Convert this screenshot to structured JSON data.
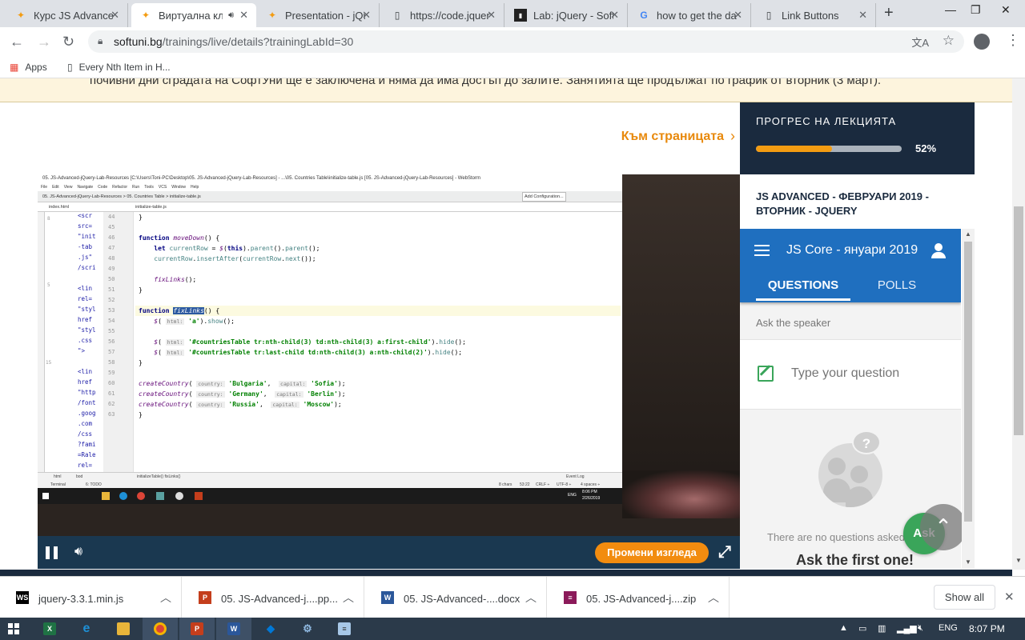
{
  "browser": {
    "tabs": [
      {
        "title": "Курс JS Advanced - ...",
        "icon": "softuni-icon"
      },
      {
        "title": "Виртуална класна стая",
        "icon": "softuni-icon",
        "active": true,
        "audio": true
      },
      {
        "title": "Presentation - jQuery",
        "icon": "softuni-icon"
      },
      {
        "title": "https://code.jquery.com",
        "icon": "document-icon"
      },
      {
        "title": "Lab: jQuery - SoftUni",
        "icon": "terminal-icon"
      },
      {
        "title": "how to get the data",
        "icon": "google-icon"
      },
      {
        "title": "Link Buttons",
        "icon": "document-icon"
      }
    ],
    "url_host": "softuni.bg",
    "url_path": "/trainings/live/details?trainingLabId=30",
    "bookmarks": [
      {
        "label": "Apps",
        "icon": "apps-grid-icon"
      },
      {
        "label": "Every Nth Item in H...",
        "icon": "document-icon"
      }
    ]
  },
  "page": {
    "notice": "почивни дни сградата на СофтУни ще е заключена и няма да има достъп до залите. Занятията ще продължат по график от вторник (3 март).",
    "page_link": "Към страницата",
    "progress_title": "ПРОГРЕС НА ЛЕКЦИЯТА",
    "progress_value": 0.52,
    "progress_label": "52%",
    "course_title": "JS ADVANCED - ФЕВРУАРИ 2019 - ВТОРНИК - JQUERY",
    "accent_color": "#f28c0f"
  },
  "video": {
    "change_view_label": "Промени изгледа",
    "ide": {
      "title": "05. JS-Advanced-jQuery-Lab-Resources [C:\\Users\\Toni-PC\\Desktop\\05. JS-Advanced-jQuery-Lab-Resources] - ...\\05. Countries Table\\initialize-table.js [05. JS-Advanced-jQuery-Lab-Resources] - WebStorm",
      "menu": [
        "File",
        "Edit",
        "View",
        "Navigate",
        "Code",
        "Refactor",
        "Run",
        "Tools",
        "VCS",
        "Window",
        "Help"
      ],
      "crumbs": [
        "05. JS-Advanced-jQuery-Lab-Resources",
        "05. Countries Table",
        "initialize-table.js"
      ],
      "add_config": "Add Configuration...",
      "file_tabs": [
        "index.html",
        "initialize-table.js"
      ],
      "gutter_lines": [
        "44",
        "45",
        "46",
        "47",
        "48",
        "49",
        "50",
        "51",
        "52",
        "53",
        "54",
        "55",
        "56",
        "57",
        "58",
        "59",
        "60",
        "61",
        "62",
        "63"
      ],
      "html_lines": [
        "<scr",
        "src=",
        "\"init",
        "-tab",
        ".js\"",
        "/scri",
        "",
        "<lin",
        "rel=",
        "\"styl",
        "href",
        "\"styl",
        ".css",
        "\">",
        "",
        "<lin",
        "href",
        "\"http",
        "/font",
        ".goog",
        ".com",
        "/css",
        "?fami",
        "=Rale",
        "rel="
      ],
      "html_gutter": [
        "8",
        "5",
        "15"
      ],
      "status_left": "initializeTable()  fixLinks()",
      "status_right": [
        "8 chars",
        "53:22",
        "CRLF ÷",
        "UTF-8 ÷",
        "4 spaces ÷"
      ],
      "event_log": "Event Log",
      "terminal_tab": "Terminal",
      "todo_tab": "6: TODO",
      "html_footer": [
        "html",
        "bod"
      ],
      "tray_time": "8:06 PM",
      "tray_date": "2/26/2019",
      "tray_lang": "ENG"
    }
  },
  "slido": {
    "event_name": "JS Core - януари 2019",
    "tab_questions": "QUESTIONS",
    "tab_polls": "POLLS",
    "ask_label": "Ask the speaker",
    "question_placeholder": "Type your question",
    "no_questions": "There are no questions asked yet.",
    "ask_first": "Ask the first one!",
    "ask_button": "Ask",
    "brand_color": "#1f6fbf"
  },
  "downloads": {
    "items": [
      {
        "name": "jquery-3.3.1.min.js",
        "icon": "webstorm-icon",
        "color": "#000000"
      },
      {
        "name": "05. JS-Advanced-j....pp...",
        "icon": "powerpoint-icon",
        "color": "#c43e1c"
      },
      {
        "name": "05. JS-Advanced-....docx",
        "icon": "word-icon",
        "color": "#2b579a"
      },
      {
        "name": "05. JS-Advanced-j....zip",
        "icon": "winrar-icon",
        "color": "#8b1a5a"
      }
    ],
    "show_all": "Show all"
  },
  "taskbar": {
    "apps": [
      {
        "icon": "excel-icon",
        "color": "#1f7244",
        "glyph": "X"
      },
      {
        "icon": "ie-icon",
        "color": "#1e90d6",
        "glyph": "e"
      },
      {
        "icon": "file-explorer-icon",
        "color": "#e8b53a",
        "glyph": ""
      },
      {
        "icon": "chrome-icon",
        "color": "#db4437",
        "glyph": ""
      },
      {
        "icon": "powerpoint-icon",
        "color": "#c43e1c",
        "glyph": "P"
      },
      {
        "icon": "word-icon",
        "color": "#2b579a",
        "glyph": "W"
      },
      {
        "icon": "vscode-icon",
        "color": "#0078d7",
        "glyph": "◆"
      },
      {
        "icon": "network-icon",
        "color": "#5d8fbf",
        "glyph": "⚙"
      },
      {
        "icon": "notepad-icon",
        "color": "#a7c7e7",
        "glyph": "≡"
      }
    ],
    "lang": "ENG",
    "time": "8:07 PM"
  }
}
